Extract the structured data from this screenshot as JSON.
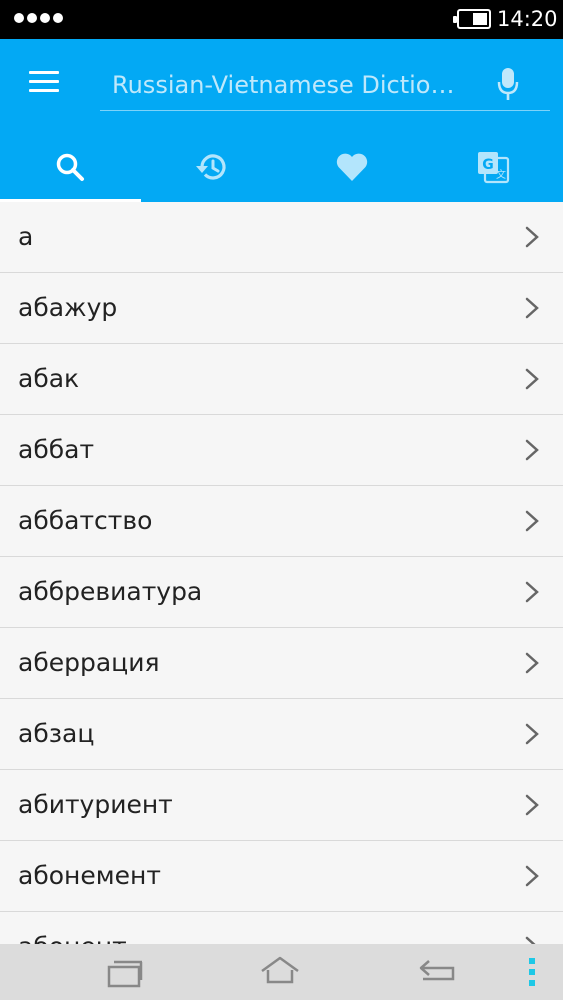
{
  "status_bar": {
    "time": "14:20",
    "battery_level": 0.55,
    "signal_dots": 4
  },
  "app_bar": {
    "search_placeholder": "Russian-Vietnamese Dictio…",
    "menu_icon": "hamburger-menu-icon",
    "mic_icon": "microphone-icon",
    "background_color": "#03a9f4"
  },
  "tabs": [
    {
      "icon": "search-icon",
      "active": true
    },
    {
      "icon": "history-icon",
      "active": false
    },
    {
      "icon": "heart-icon",
      "active": false
    },
    {
      "icon": "translate-icon",
      "active": false
    }
  ],
  "words": [
    "а",
    "абажур",
    "абак",
    "аббат",
    "аббатство",
    "аббревиатура",
    "аберрация",
    "абзац",
    "абитуриент",
    "абонемент",
    "абонент"
  ],
  "nav_bar": {
    "recent_icon": "recent-apps-icon",
    "home_icon": "home-icon",
    "back_icon": "back-icon",
    "menu_icon": "overflow-menu-icon",
    "accent_color": "#1ec8e6"
  }
}
